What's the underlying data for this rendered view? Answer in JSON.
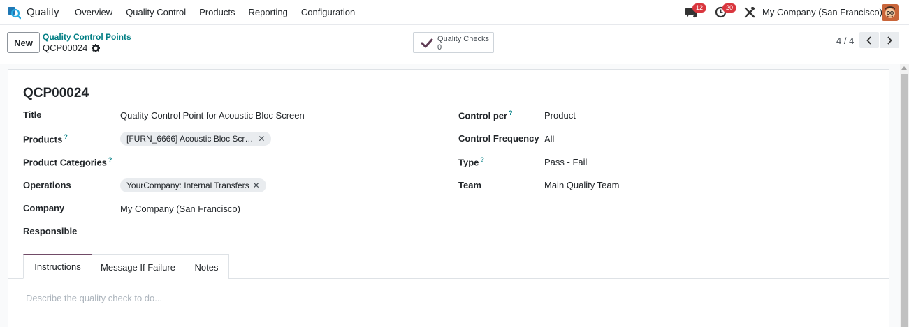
{
  "navbar": {
    "app_name": "Quality",
    "menu": [
      "Overview",
      "Quality Control",
      "Products",
      "Reporting",
      "Configuration"
    ],
    "messages_badge": "12",
    "activities_badge": "20",
    "company": "My Company (San Francisco)"
  },
  "control": {
    "new_label": "New",
    "breadcrumb_parent": "Quality Control Points",
    "breadcrumb_record": "QCP00024",
    "smart_button_label": "Quality Checks",
    "smart_button_value": "0",
    "pager": "4 / 4"
  },
  "form": {
    "record_name": "QCP00024",
    "left_fields": [
      {
        "label": "Title",
        "help": "",
        "value": "Quality Control Point for Acoustic Bloc Screen"
      },
      {
        "label": "Products",
        "help": "?",
        "tag": "[FURN_6666] Acoustic Bloc Scr…"
      },
      {
        "label": "Product Categories",
        "help": "?",
        "value": ""
      },
      {
        "label": "Operations",
        "help": "",
        "tag": "YourCompany: Internal Transfers"
      },
      {
        "label": "Company",
        "help": "",
        "value": "My Company (San Francisco)"
      },
      {
        "label": "Responsible",
        "help": "",
        "value": ""
      }
    ],
    "right_fields": [
      {
        "label": "Control per",
        "help": "?",
        "value": "Product"
      },
      {
        "label": "Control Frequency",
        "help": "",
        "value": "All"
      },
      {
        "label": "Type",
        "help": "?",
        "value": "Pass - Fail"
      },
      {
        "label": "Team",
        "help": "",
        "value": "Main Quality Team"
      }
    ],
    "tabs": [
      "Instructions",
      "Message If Failure",
      "Notes"
    ],
    "active_tab": "Instructions",
    "instructions_placeholder": "Describe the quality check to do..."
  },
  "colors": {
    "accent": "#714b67",
    "link": "#017e84",
    "badge": "#d9363e"
  }
}
